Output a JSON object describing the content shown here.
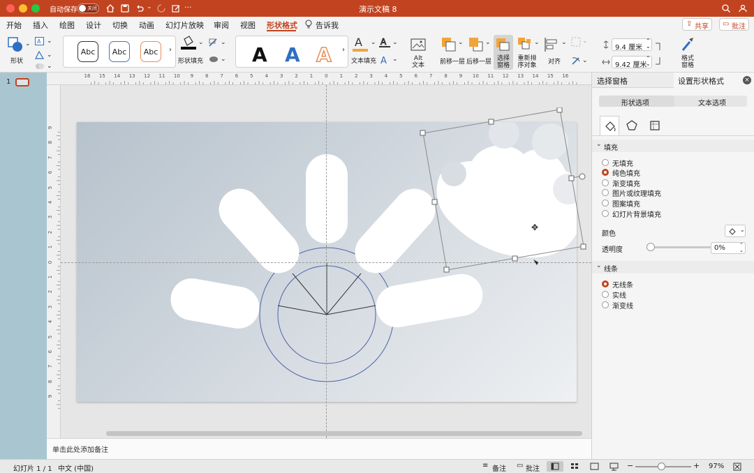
{
  "title_bar": {
    "autosave_label": "自动保存",
    "autosave_state": "关闭",
    "doc_title": "演示文稿 8"
  },
  "menu_tabs": [
    "开始",
    "插入",
    "绘图",
    "设计",
    "切换",
    "动画",
    "幻灯片放映",
    "审阅",
    "视图",
    "形状格式",
    "告诉我"
  ],
  "active_tab": "形状格式",
  "share_button": "共享",
  "comments_button": "批注",
  "ribbon": {
    "shapes_label": "形状",
    "style_samples": [
      "Abc",
      "Abc",
      "Abc"
    ],
    "shape_fill_label": "形状填充",
    "wordart_letter": "A",
    "text_fill_label": "文本填充",
    "alt_text_label": "Alt 文本",
    "bring_forward_label": "前移一层",
    "send_backward_label": "后移一层",
    "selection_pane_label": "选择 窗格",
    "reorder_label": "重新排 序对象",
    "align_label": "对齐",
    "height_value": "9.4 厘米",
    "width_value": "9.42 厘米",
    "format_pane_label": "格式 窗格"
  },
  "ruler_numbers": [
    "16",
    "15",
    "14",
    "13",
    "12",
    "11",
    "10",
    "9",
    "8",
    "7",
    "6",
    "5",
    "4",
    "3",
    "2",
    "1",
    "0",
    "1",
    "2",
    "3",
    "4",
    "5",
    "6",
    "7",
    "8",
    "9",
    "10",
    "11",
    "12",
    "13",
    "14",
    "15",
    "16"
  ],
  "v_ruler_numbers": [
    "9",
    "8",
    "7",
    "6",
    "5",
    "4",
    "3",
    "2",
    "1",
    "0",
    "1",
    "2",
    "3",
    "4",
    "5",
    "6",
    "7",
    "8",
    "9"
  ],
  "slide_number": "1",
  "notes_placeholder": "单击此处添加备注",
  "format_pane": {
    "selection_tab": "选择窗格",
    "format_tab": "设置形状格式",
    "shape_options": "形状选项",
    "text_options": "文本选项",
    "fill_section": "填充",
    "fill_options": [
      "无填充",
      "纯色填充",
      "渐变填充",
      "图片或纹理填充",
      "图案填充",
      "幻灯片背景填充"
    ],
    "fill_selected": "纯色填充",
    "color_label": "颜色",
    "transparency_label": "透明度",
    "transparency_value": "0%",
    "line_section": "线条",
    "line_options": [
      "无线条",
      "实线",
      "渐变线"
    ],
    "line_selected": "无线条"
  },
  "status": {
    "slide_count": "幻灯片 1 / 1",
    "language": "中文 (中国)",
    "notes": "备注",
    "comments": "批注",
    "zoom": "97%"
  },
  "colors": {
    "accent": "#c2431f",
    "ribbon_bg": "#f3f3f3",
    "selected_radio": "#c2431f",
    "slide_gradient_start": "#b6c2cc",
    "slide_gradient_end": "#eef0f2"
  }
}
